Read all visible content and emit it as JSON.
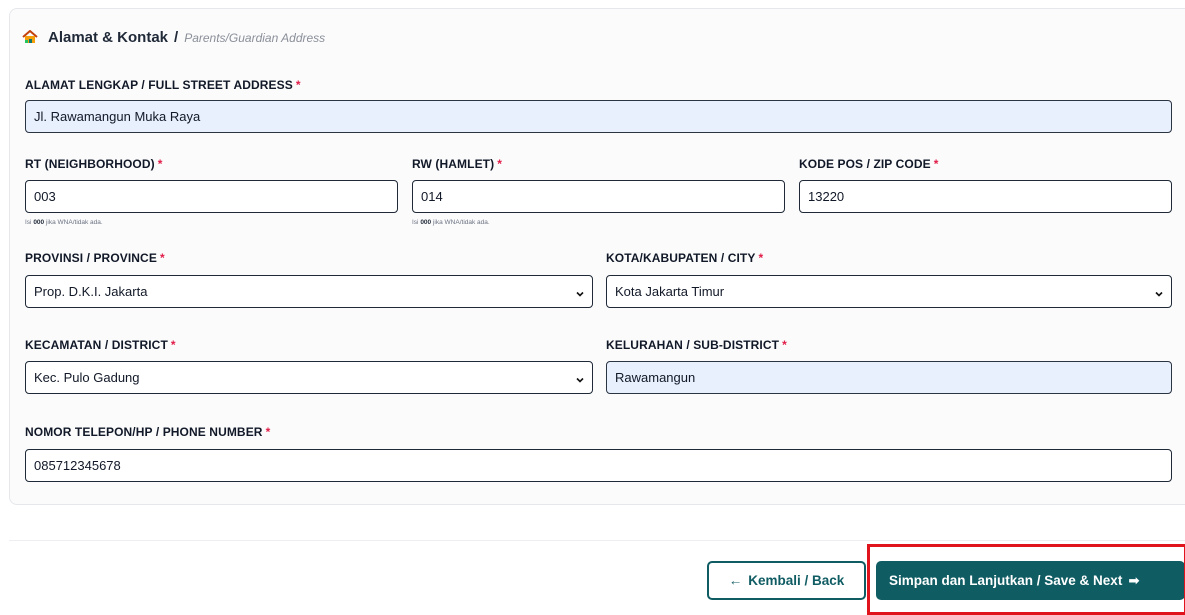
{
  "section": {
    "title": "Alamat & Kontak",
    "slash": "/",
    "subtitle": "Parents/Guardian Address"
  },
  "required_mark": "*",
  "fields": {
    "address": {
      "label": "ALAMAT LENGKAP / FULL STREET ADDRESS",
      "value": "Jl. Rawamangun Muka Raya"
    },
    "rt": {
      "label": "RT (NEIGHBORHOOD)",
      "value": "003",
      "hint_prefix": "Isi",
      "hint_bold": "000",
      "hint_suffix": "jika WNA/tidak ada."
    },
    "rw": {
      "label": "RW (HAMLET)",
      "value": "014",
      "hint_prefix": "Isi",
      "hint_bold": "000",
      "hint_suffix": "jika WNA/tidak ada."
    },
    "zip": {
      "label": "KODE POS / ZIP CODE",
      "value": "13220"
    },
    "province": {
      "label": "PROVINSI / PROVINCE",
      "value": "Prop. D.K.I. Jakarta"
    },
    "city": {
      "label": "KOTA/KABUPATEN / CITY",
      "value": "Kota Jakarta Timur"
    },
    "district": {
      "label": "KECAMATAN / DISTRICT",
      "value": "Kec. Pulo Gadung"
    },
    "subdistrict": {
      "label": "KELURAHAN / SUB-DISTRICT",
      "value": "Rawamangun"
    },
    "phone": {
      "label": "NOMOR TELEPON/HP / PHONE NUMBER",
      "value": "085712345678"
    }
  },
  "buttons": {
    "back": {
      "arrow": "←",
      "label": "Kembali / Back"
    },
    "next": {
      "label": "Simpan dan Lanjutkan / Save & Next",
      "arrow": "➡"
    }
  },
  "icons": {
    "section": "house-icon",
    "select": "chevron-down-icon"
  },
  "colors": {
    "primary": "#0f5c63",
    "required": "#e11d48",
    "filled_background": "#e8effd",
    "highlight": "#e0141c"
  }
}
